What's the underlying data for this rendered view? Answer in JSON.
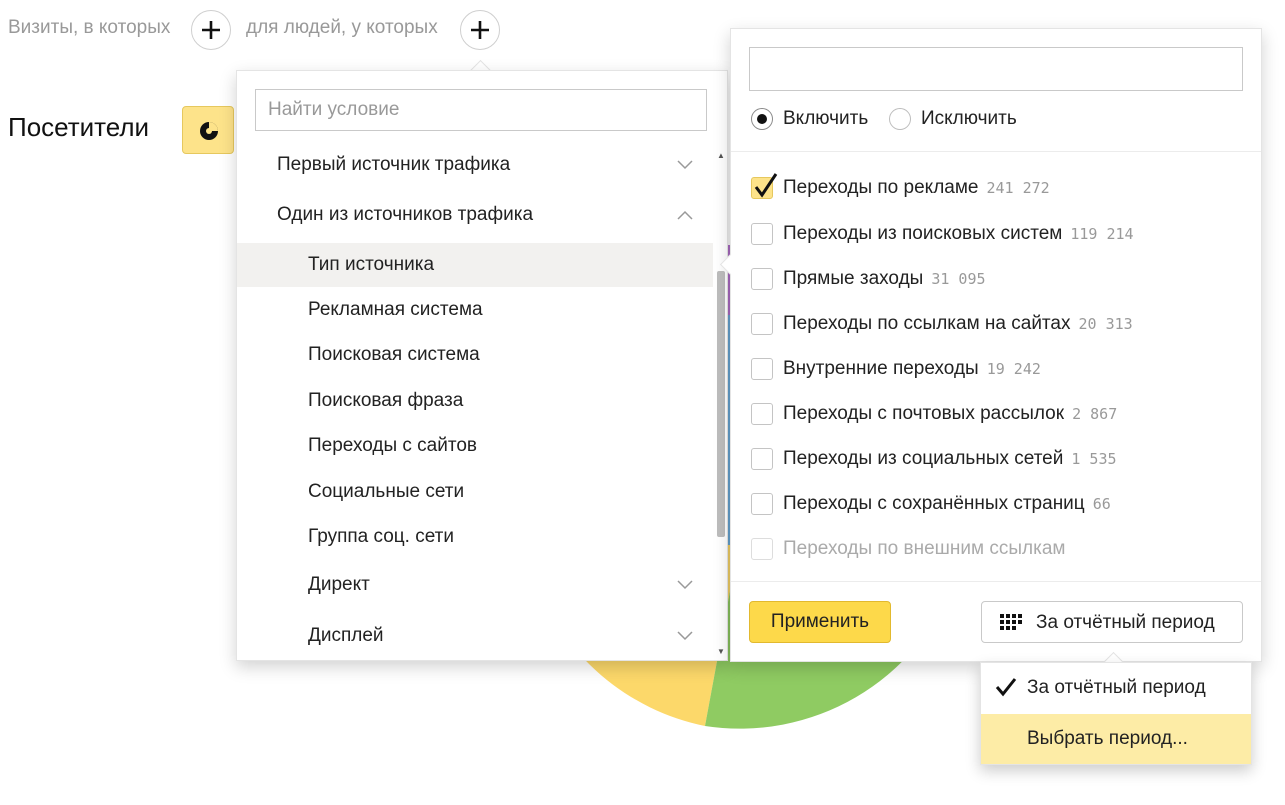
{
  "segmentation": {
    "visits_label": "Визиты, в которых",
    "people_label": "для людей, у которых"
  },
  "page": {
    "title": "Посетители"
  },
  "pie_colors": [
    "#fcd86a",
    "#8fcb62",
    "#b16fc9",
    "#6aa9d8"
  ],
  "conditions": {
    "search_placeholder": "Найти условие",
    "items": [
      {
        "label": "Первый источник трафика",
        "chevron": "down"
      },
      {
        "label": "Один из источников трафика",
        "chevron": "up"
      },
      {
        "label": "Тип источника"
      },
      {
        "label": "Рекламная система"
      },
      {
        "label": "Поисковая система"
      },
      {
        "label": "Поисковая фраза"
      },
      {
        "label": "Переходы с сайтов"
      },
      {
        "label": "Социальные сети"
      },
      {
        "label": "Группа соц. сети"
      },
      {
        "label": "Директ",
        "chevron": "down"
      },
      {
        "label": "Дисплей",
        "chevron": "down"
      }
    ]
  },
  "filter": {
    "search_value": "",
    "include_label": "Включить",
    "exclude_label": "Исключить",
    "mode": "include",
    "options": [
      {
        "label": "Переходы по рекламе",
        "count": "241 272",
        "checked": true
      },
      {
        "label": "Переходы из поисковых систем",
        "count": "119 214",
        "checked": false
      },
      {
        "label": "Прямые заходы",
        "count": "31 095",
        "checked": false
      },
      {
        "label": "Переходы по ссылкам на сайтах",
        "count": "20 313",
        "checked": false
      },
      {
        "label": "Внутренние переходы",
        "count": "19 242",
        "checked": false
      },
      {
        "label": "Переходы с почтовых рассылок",
        "count": "2 867",
        "checked": false
      },
      {
        "label": "Переходы из социальных сетей",
        "count": "1 535",
        "checked": false
      },
      {
        "label": "Переходы с сохранённых страниц",
        "count": "66",
        "checked": false
      },
      {
        "label": "Переходы по внешним ссылкам",
        "count": "",
        "checked": false,
        "disabled": true
      }
    ],
    "apply_label": "Применить",
    "period_label": "За отчётный период"
  },
  "period_menu": {
    "items": [
      {
        "label": "За отчётный период",
        "selected": true
      },
      {
        "label": "Выбрать период...",
        "selected": false
      }
    ]
  }
}
